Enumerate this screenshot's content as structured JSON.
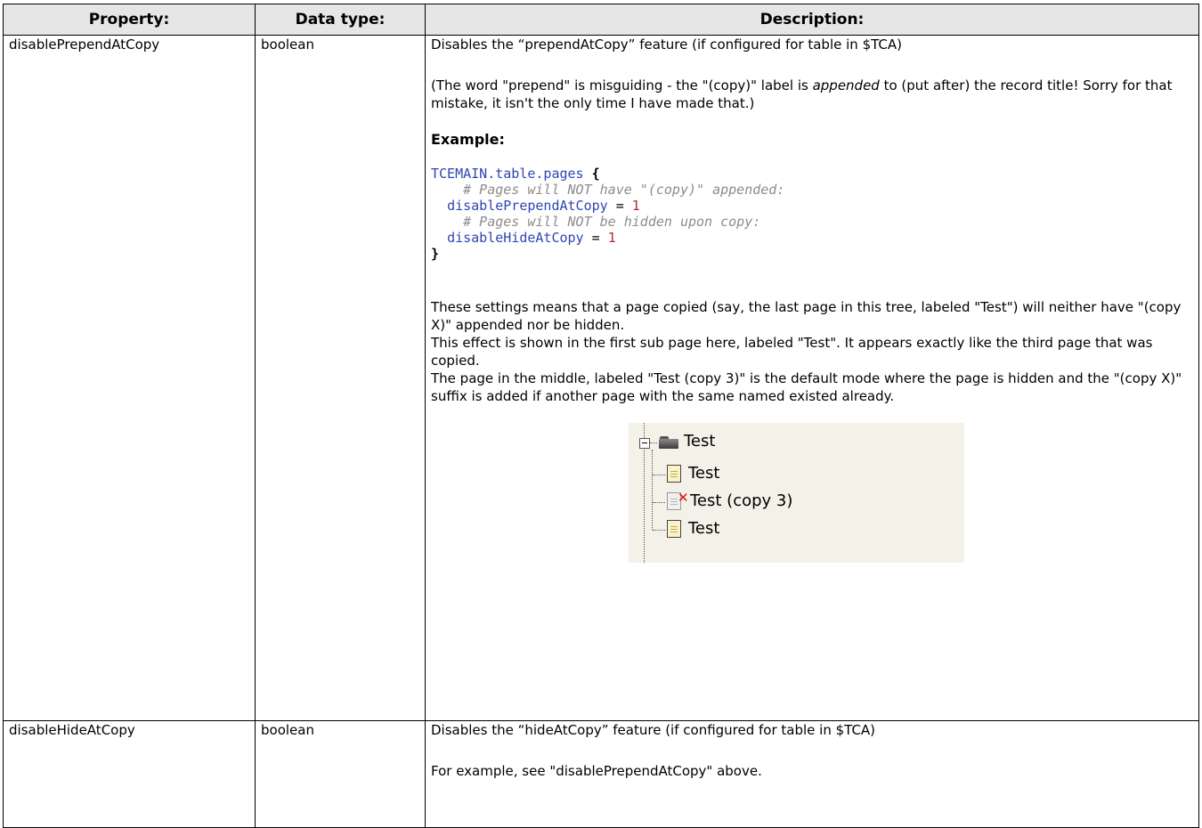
{
  "headers": {
    "property": "Property:",
    "data_type": "Data type:",
    "description": "Description:"
  },
  "rows": [
    {
      "property": "disablePrependAtCopy",
      "type": "boolean",
      "intro": "Disables the “prependAtCopy” feature (if configured for table in $TCA)",
      "note_before": "(The word \"prepend\" is misguiding - the \"(copy)\" label is ",
      "note_em": "appended",
      "note_after": "  to (put after) the record title! Sorry for that mistake, it isn't the only time I have made that.)",
      "example_heading": "Example:",
      "code": {
        "l1_ident": "TCEMAIN.table.pages",
        "l1_brace": "{",
        "l2_comment": "# Pages will NOT have \"(copy)\" appended:",
        "l3_ident": "disablePrependAtCopy",
        "l3_op": "=",
        "l3_num": "1",
        "l4_comment": "# Pages will NOT be hidden upon copy:",
        "l5_ident": "disableHideAtCopy",
        "l5_op": "=",
        "l5_num": "1",
        "l6_brace": "}"
      },
      "explanation": [
        "These settings means that a page copied (say, the last page in this tree, labeled \"Test\") will neither have \"(copy X)\" appended nor be hidden.",
        "This effect is shown in the first sub page here, labeled \"Test\". It appears exactly like the third page that was copied.",
        "The page in the middle, labeled \"Test (copy 3)\" is the default mode where the page is hidden and the \"(copy X)\" suffix is added if another page with the same named existed already."
      ],
      "tree": {
        "root_icon": "folder-icon",
        "root_label": "Test",
        "children": [
          {
            "icon": "page-icon",
            "label": "Test"
          },
          {
            "icon": "page-hidden-icon",
            "label": "Test (copy 3)"
          },
          {
            "icon": "page-icon",
            "label": "Test"
          }
        ]
      }
    },
    {
      "property": "disableHideAtCopy",
      "type": "boolean",
      "intro": "Disables the “hideAtCopy” feature (if configured for table in $TCA)",
      "see_also": "For example, see \"disablePrependAtCopy\" above."
    }
  ],
  "colors": {
    "header_bg": "#e6e6e6",
    "code_ident": "#2f45b3",
    "code_number": "#b8282e",
    "code_comment": "#8c8c8c",
    "tree_bg": "#f4f1e8",
    "hidden_mark": "#e01010"
  }
}
